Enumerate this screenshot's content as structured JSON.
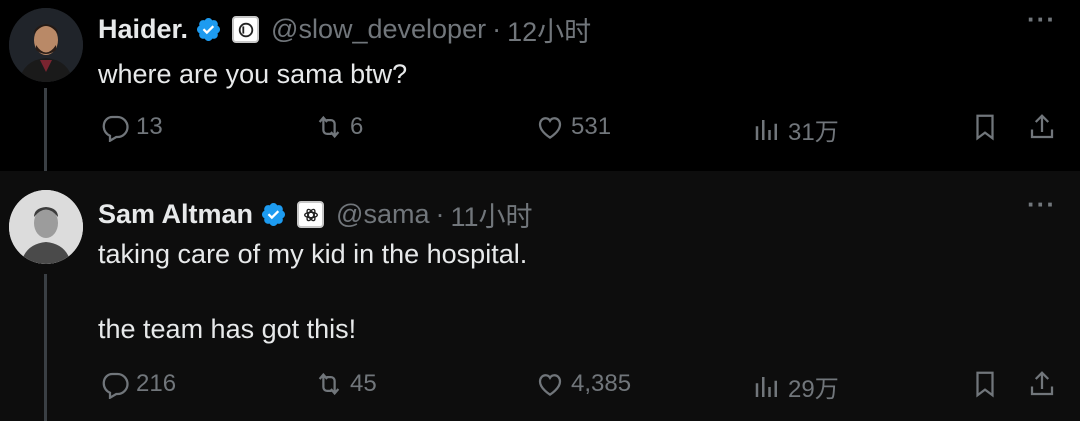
{
  "tweets": [
    {
      "name": "Haider.",
      "handle": "@slow_developer",
      "separator": "·",
      "time": "12小时",
      "text_lines": [
        "where are you sama btw?"
      ],
      "stats": {
        "replies": "13",
        "retweets": "6",
        "likes": "531",
        "views": "31万"
      },
      "more": "···"
    },
    {
      "name": "Sam Altman",
      "handle": "@sama",
      "separator": "·",
      "time": "11小时",
      "text_lines": [
        "taking care of my kid in the hospital.",
        "the team has got this!"
      ],
      "stats": {
        "replies": "216",
        "retweets": "45",
        "likes": "4,385",
        "views": "29万"
      },
      "more": "···"
    }
  ],
  "colors": {
    "background": "#000000",
    "reply_background": "#0d0d0d",
    "text": "#e7e9ea",
    "muted": "#71767b",
    "verified": "#1d9bf0"
  },
  "icons": [
    "reply-icon",
    "retweet-icon",
    "like-icon",
    "views-icon",
    "bookmark-icon",
    "share-icon",
    "verified-badge-icon",
    "more-icon"
  ]
}
